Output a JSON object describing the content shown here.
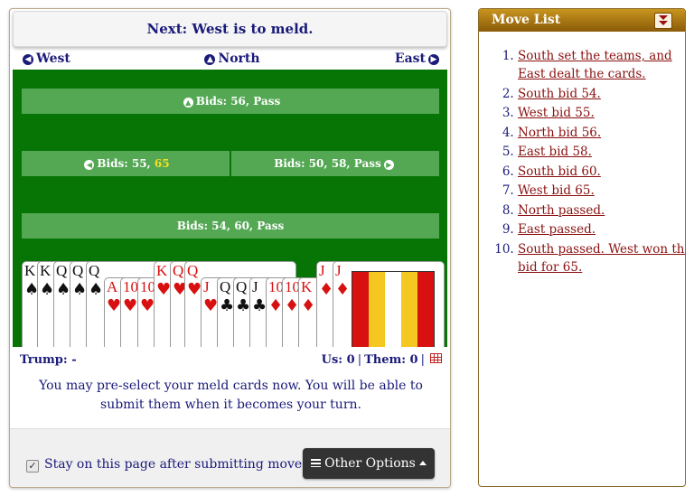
{
  "header": {
    "next": "Next: West is to meld."
  },
  "nav": {
    "west": "West",
    "north": "North",
    "east": "East"
  },
  "bids": {
    "north": "Bids: 56, Pass",
    "west_prefix": "Bids: 55, ",
    "west_highlight": "65",
    "east": "Bids: 50, 58, Pass",
    "south": "Bids: 54, 60, Pass"
  },
  "hand": {
    "cards": [
      {
        "rank": "K",
        "suit": "♠",
        "color": "black"
      },
      {
        "rank": "K",
        "suit": "♠",
        "color": "black"
      },
      {
        "rank": "Q",
        "suit": "♠",
        "color": "black"
      },
      {
        "rank": "Q",
        "suit": "♠",
        "color": "black"
      },
      {
        "rank": "Q",
        "suit": "♠",
        "color": "black"
      },
      {
        "rank": "A",
        "suit": "♥",
        "color": "red"
      },
      {
        "rank": "10",
        "suit": "♥",
        "color": "red"
      },
      {
        "rank": "10",
        "suit": "♥",
        "color": "red"
      },
      {
        "rank": "K",
        "suit": "♥",
        "color": "red"
      },
      {
        "rank": "Q",
        "suit": "♥",
        "color": "red"
      },
      {
        "rank": "Q",
        "suit": "♥",
        "color": "red"
      },
      {
        "rank": "J",
        "suit": "♥",
        "color": "red"
      },
      {
        "rank": "Q",
        "suit": "♣",
        "color": "black"
      },
      {
        "rank": "Q",
        "suit": "♣",
        "color": "black"
      },
      {
        "rank": "J",
        "suit": "♣",
        "color": "black"
      },
      {
        "rank": "10",
        "suit": "♦",
        "color": "red"
      },
      {
        "rank": "10",
        "suit": "♦",
        "color": "red"
      },
      {
        "rank": "K",
        "suit": "♦",
        "color": "red"
      }
    ],
    "right_cards": [
      {
        "rank": "J",
        "suit": "♦",
        "color": "red"
      },
      {
        "rank": "J",
        "suit": "♦",
        "color": "red"
      }
    ]
  },
  "status": {
    "trump": "Trump: -",
    "us": "Us: 0",
    "them": "Them: 0",
    "sep": "|"
  },
  "notice": "You may pre-select your meld cards now. You will be able to submit them when it becomes your turn.",
  "footer": {
    "stay_label": "Stay on this page after submitting move.",
    "stay_checked": true,
    "options_label": "Other Options"
  },
  "move_list": {
    "title": "Move List",
    "items": [
      "South set the teams, and East dealt the cards.",
      "South bid 54.",
      "West bid 55.",
      "North bid 56.",
      "East bid 58.",
      "South bid 60.",
      "West bid 65.",
      "North passed.",
      "East passed.",
      "South passed. West won the bid for 65."
    ]
  },
  "colors": {
    "felt": "#067506",
    "bid_box": "#54a854",
    "navy": "#1a1a7a",
    "link": "#8a1010",
    "header_gold": "#b07a12"
  }
}
